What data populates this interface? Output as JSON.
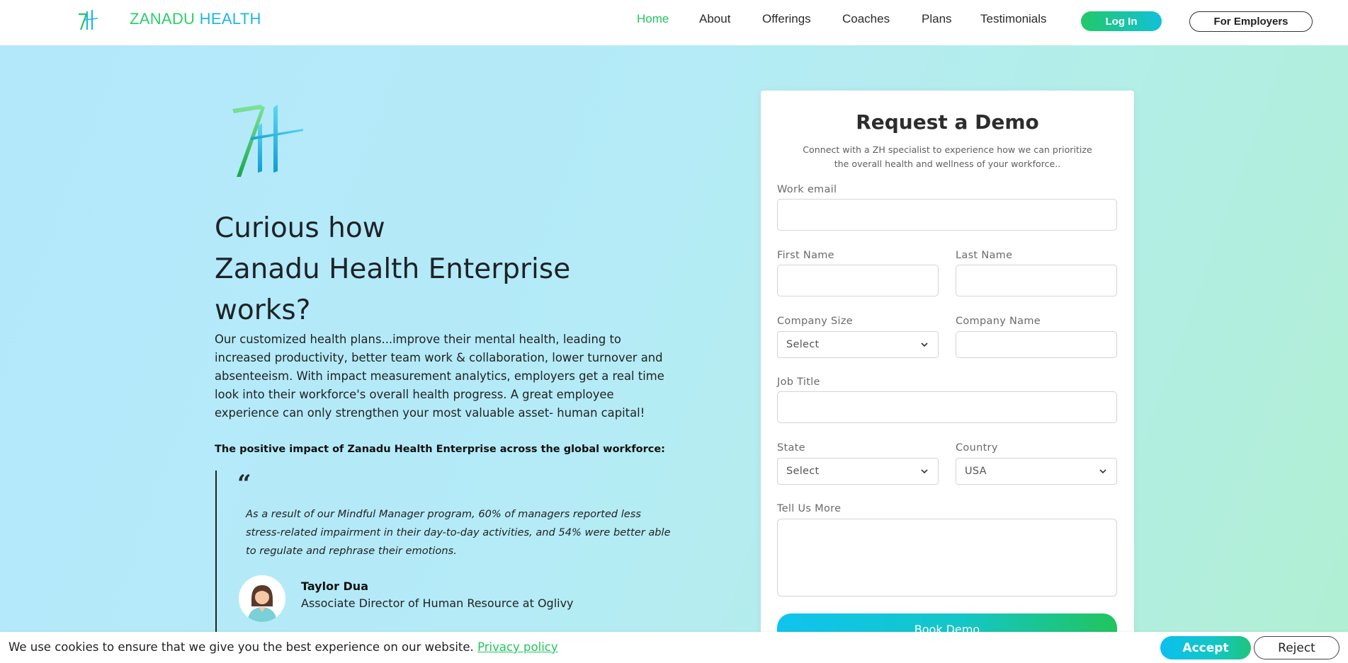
{
  "header": {
    "brand_word1": "ZANADU",
    "brand_word2": "HEALTH",
    "nav": [
      {
        "label": "Home",
        "active": true
      },
      {
        "label": "About"
      },
      {
        "label": "Offerings"
      },
      {
        "label": "Coaches"
      },
      {
        "label": "Plans"
      },
      {
        "label": "Testimonials"
      }
    ],
    "login_label": "Log In",
    "employers_label": "For Employers"
  },
  "hero": {
    "title_lines": [
      "Curious how",
      "Zanadu Health Enterprise",
      "works?"
    ],
    "body": "Our customized health plans...improve their mental health, leading to increased productivity, better team work & collaboration, lower turnover and absenteeism. With impact measurement analytics, employers get a real time look into their workforce's overall health progress. A great employee experience can only strengthen your most valuable asset- human capital!",
    "impact_heading": "The positive impact of Zanadu Health Enterprise across the global workforce:",
    "quote_mark": "“",
    "quote": "As a result of our Mindful Manager program, 60% of managers reported less stress-related impairment in their day-to-day activities, and 54% were better able to regulate and rephrase their emotions.",
    "author_name": "Taylor Dua",
    "author_role": "Associate Director of Human Resource at Oglivy"
  },
  "form": {
    "title": "Request a Demo",
    "subtitle": "Connect with a ZH specialist to experience how we can prioritize the overall health and wellness of your workforce..",
    "work_email_label": "Work email",
    "work_email_value": "",
    "first_name_label": "First Name",
    "last_name_label": "Last Name",
    "company_size_label": "Company Size",
    "company_size_value": "Select",
    "company_name_label": "Company Name",
    "job_title_label": "Job Title",
    "state_label": "State",
    "state_value": "Select",
    "country_label": "Country",
    "country_value": "USA",
    "tell_more_label": "Tell Us More",
    "submit_label": "Book Demo"
  },
  "cookie": {
    "text": "We use cookies to ensure that we give you the best experience on our website.",
    "link": "Privacy policy",
    "accept_label": "Accept",
    "reject_label": "Reject"
  },
  "colors": {
    "brand_green": "#22c55e",
    "brand_blue": "#1cb7e6",
    "background_start": "#b3e8fb",
    "background_end": "#b1efd3"
  },
  "icons": [
    "zh-logo-icon",
    "chevron-down-icon",
    "avatar-icon"
  ]
}
